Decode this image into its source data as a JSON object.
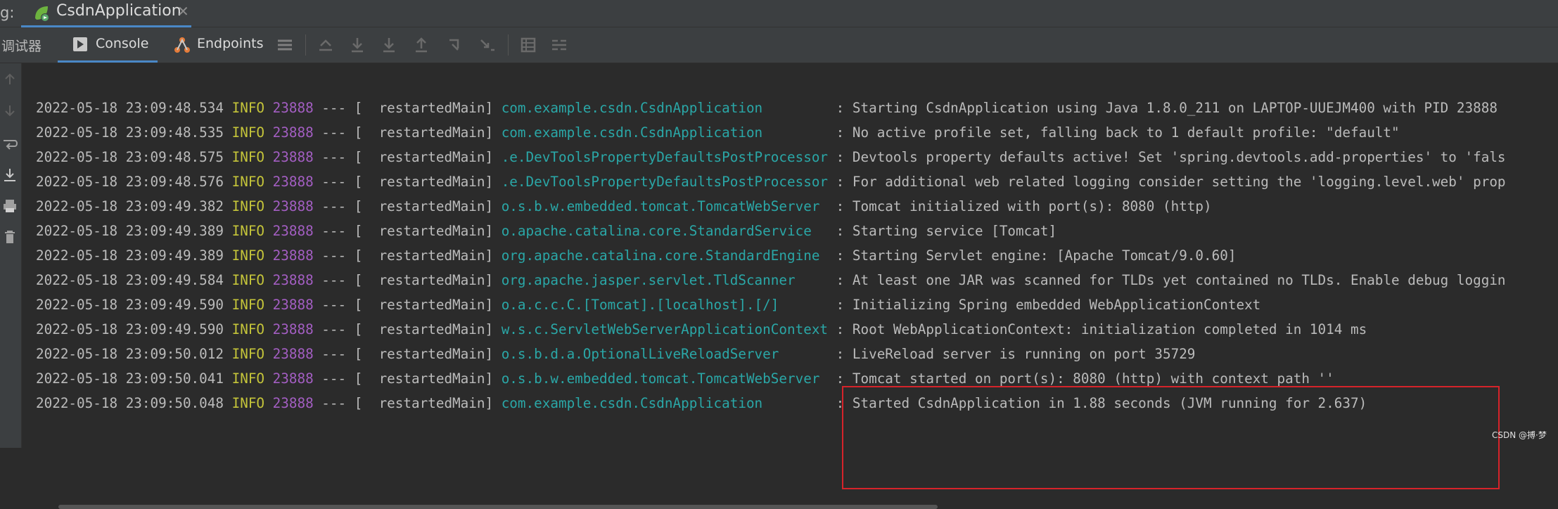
{
  "tabbar": {
    "prefix": "g:",
    "run_tab": {
      "label": "CsdnApplication",
      "close": "✕"
    }
  },
  "toolbar": {
    "debugger_label": "调试器",
    "console_label": "Console",
    "endpoints_label": "Endpoints"
  },
  "console": {
    "lines": [
      {
        "ts": "2022-05-18 23:09:48.534",
        "level": "INFO",
        "pid": "23888",
        "sep": " --- [",
        "thread": "  restartedMain] ",
        "logger": "com.example.csdn.CsdnApplication        ",
        "msg": " : Starting CsdnApplication using Java 1.8.0_211 on LAPTOP-UUEJM400 with PID 23888"
      },
      {
        "ts": "2022-05-18 23:09:48.535",
        "level": "INFO",
        "pid": "23888",
        "sep": " --- [",
        "thread": "  restartedMain] ",
        "logger": "com.example.csdn.CsdnApplication        ",
        "msg": " : No active profile set, falling back to 1 default profile: \"default\""
      },
      {
        "ts": "2022-05-18 23:09:48.575",
        "level": "INFO",
        "pid": "23888",
        "sep": " --- [",
        "thread": "  restartedMain] ",
        "logger": ".e.DevToolsPropertyDefaultsPostProcessor",
        "msg": " : Devtools property defaults active! Set 'spring.devtools.add-properties' to 'fals"
      },
      {
        "ts": "2022-05-18 23:09:48.576",
        "level": "INFO",
        "pid": "23888",
        "sep": " --- [",
        "thread": "  restartedMain] ",
        "logger": ".e.DevToolsPropertyDefaultsPostProcessor",
        "msg": " : For additional web related logging consider setting the 'logging.level.web' prop"
      },
      {
        "ts": "2022-05-18 23:09:49.382",
        "level": "INFO",
        "pid": "23888",
        "sep": " --- [",
        "thread": "  restartedMain] ",
        "logger": "o.s.b.w.embedded.tomcat.TomcatWebServer ",
        "msg": " : Tomcat initialized with port(s): 8080 (http)"
      },
      {
        "ts": "2022-05-18 23:09:49.389",
        "level": "INFO",
        "pid": "23888",
        "sep": " --- [",
        "thread": "  restartedMain] ",
        "logger": "o.apache.catalina.core.StandardService  ",
        "msg": " : Starting service [Tomcat]"
      },
      {
        "ts": "2022-05-18 23:09:49.389",
        "level": "INFO",
        "pid": "23888",
        "sep": " --- [",
        "thread": "  restartedMain] ",
        "logger": "org.apache.catalina.core.StandardEngine ",
        "msg": " : Starting Servlet engine: [Apache Tomcat/9.0.60]"
      },
      {
        "ts": "2022-05-18 23:09:49.584",
        "level": "INFO",
        "pid": "23888",
        "sep": " --- [",
        "thread": "  restartedMain] ",
        "logger": "org.apache.jasper.servlet.TldScanner    ",
        "msg": " : At least one JAR was scanned for TLDs yet contained no TLDs. Enable debug loggin"
      },
      {
        "ts": "2022-05-18 23:09:49.590",
        "level": "INFO",
        "pid": "23888",
        "sep": " --- [",
        "thread": "  restartedMain] ",
        "logger": "o.a.c.c.C.[Tomcat].[localhost].[/]      ",
        "msg": " : Initializing Spring embedded WebApplicationContext"
      },
      {
        "ts": "2022-05-18 23:09:49.590",
        "level": "INFO",
        "pid": "23888",
        "sep": " --- [",
        "thread": "  restartedMain] ",
        "logger": "w.s.c.ServletWebServerApplicationContext",
        "msg": " : Root WebApplicationContext: initialization completed in 1014 ms"
      },
      {
        "ts": "2022-05-18 23:09:50.012",
        "level": "INFO",
        "pid": "23888",
        "sep": " --- [",
        "thread": "  restartedMain] ",
        "logger": "o.s.b.d.a.OptionalLiveReloadServer      ",
        "msg": " : LiveReload server is running on port 35729"
      },
      {
        "ts": "2022-05-18 23:09:50.041",
        "level": "INFO",
        "pid": "23888",
        "sep": " --- [",
        "thread": "  restartedMain] ",
        "logger": "o.s.b.w.embedded.tomcat.TomcatWebServer ",
        "msg": " : Tomcat started on port(s): 8080 (http) with context path ''"
      },
      {
        "ts": "2022-05-18 23:09:50.048",
        "level": "INFO",
        "pid": "23888",
        "sep": " --- [",
        "thread": "  restartedMain] ",
        "logger": "com.example.csdn.CsdnApplication        ",
        "msg": " : Started CsdnApplication in 1.88 seconds (JVM running for 2.637)"
      }
    ]
  },
  "watermark": "CSDN @搏·梦",
  "colors": {
    "accent": "#4a88c7",
    "level": "#c5c53a",
    "pid": "#a35ec2",
    "logger": "#2aa7a7",
    "highlight_box": "#d6232a"
  },
  "icons": {
    "run_tab": "spring-boot-app-icon",
    "console": "console-icon",
    "endpoints": "endpoints-icon"
  }
}
